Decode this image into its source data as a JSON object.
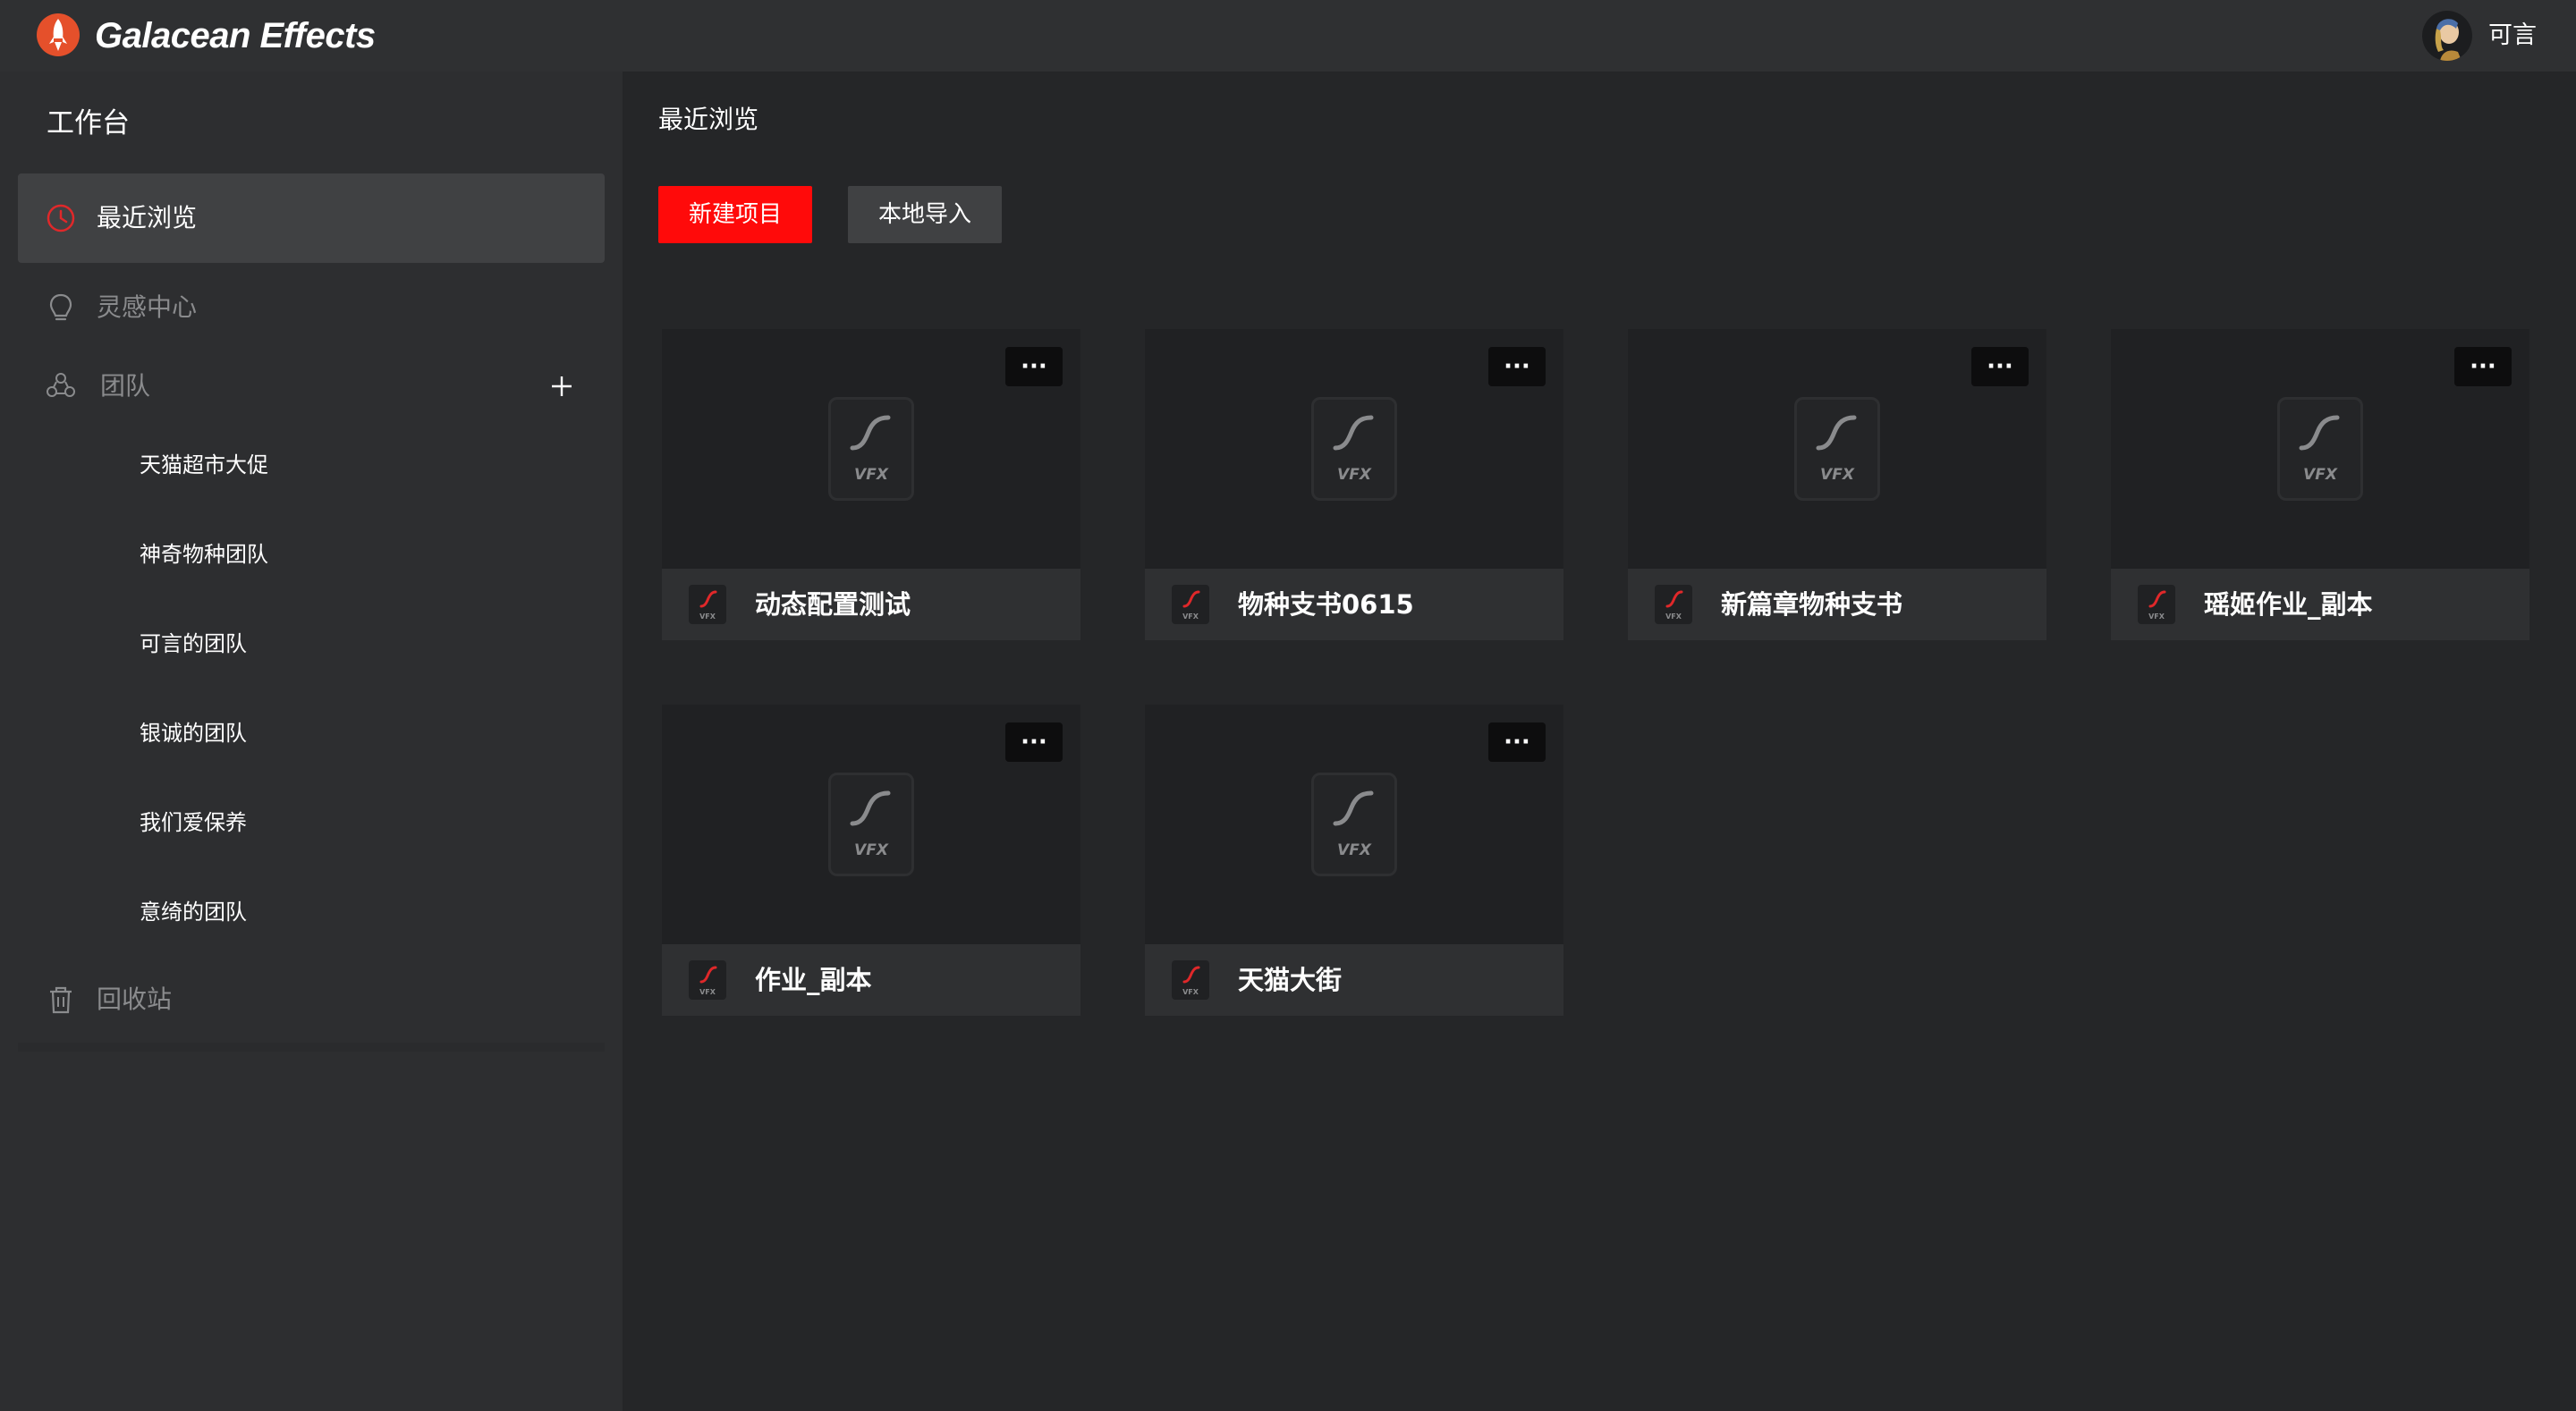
{
  "header": {
    "brand": "Galacean Effects",
    "user_name": "可言"
  },
  "sidebar": {
    "title": "工作台",
    "recent_label": "最近浏览",
    "inspiration_label": "灵感中心",
    "team_label": "团队",
    "teams": [
      "天猫超市大促",
      "神奇物种团队",
      "可言的团队",
      "银诚的团队",
      "我们爱保养",
      "意绮的团队"
    ],
    "trash_label": "回收站"
  },
  "main": {
    "title": "最近浏览",
    "new_project_label": "新建项目",
    "import_label": "本地导入",
    "thumbnail_badge": "VFX",
    "more_glyph": "···",
    "projects": [
      {
        "name": "动态配置测试"
      },
      {
        "name": "物种支书0615"
      },
      {
        "name": "新篇章物种支书"
      },
      {
        "name": "瑶姬作业_副本"
      },
      {
        "name": "作业_副本"
      },
      {
        "name": "天猫大街"
      }
    ]
  },
  "colors": {
    "accent": "#ff0a0a",
    "background": "#252628",
    "sidebar": "#2d2e30",
    "topbar": "#2f3032"
  },
  "icons": {
    "logo": "galacean-rocket-logo",
    "recent": "clock-icon",
    "inspiration": "lightbulb-icon",
    "team": "team-icon",
    "add": "plus-icon",
    "trash": "trash-icon",
    "more": "ellipsis-icon",
    "thumbnail": "vfx-file-icon"
  }
}
